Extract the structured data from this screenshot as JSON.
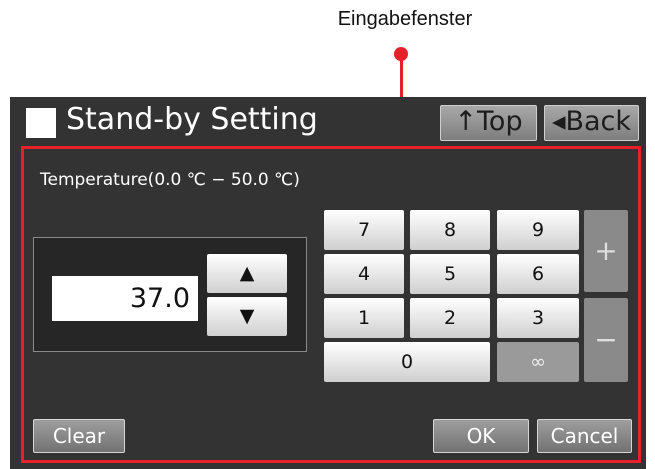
{
  "annotation": {
    "label": "Eingabefenster",
    "accent_color": "#e8202a"
  },
  "header": {
    "title": "Stand-by Setting",
    "top_button": "↑Top",
    "back_button": "◂Back"
  },
  "input": {
    "temperature_label": "Temperature(0.0 ℃ − 50.0 ℃)",
    "value": "37.0",
    "increase_symbol": "▲",
    "decrease_symbol": "▼"
  },
  "keypad": {
    "k7": "7",
    "k8": "8",
    "k9": "9",
    "k4": "4",
    "k5": "5",
    "k6": "6",
    "k1": "1",
    "k2": "2",
    "k3": "3",
    "k0": "0",
    "infinity": "∞",
    "plus": "+",
    "minus": "−"
  },
  "footer": {
    "clear": "Clear",
    "ok": "OK",
    "cancel": "Cancel"
  }
}
